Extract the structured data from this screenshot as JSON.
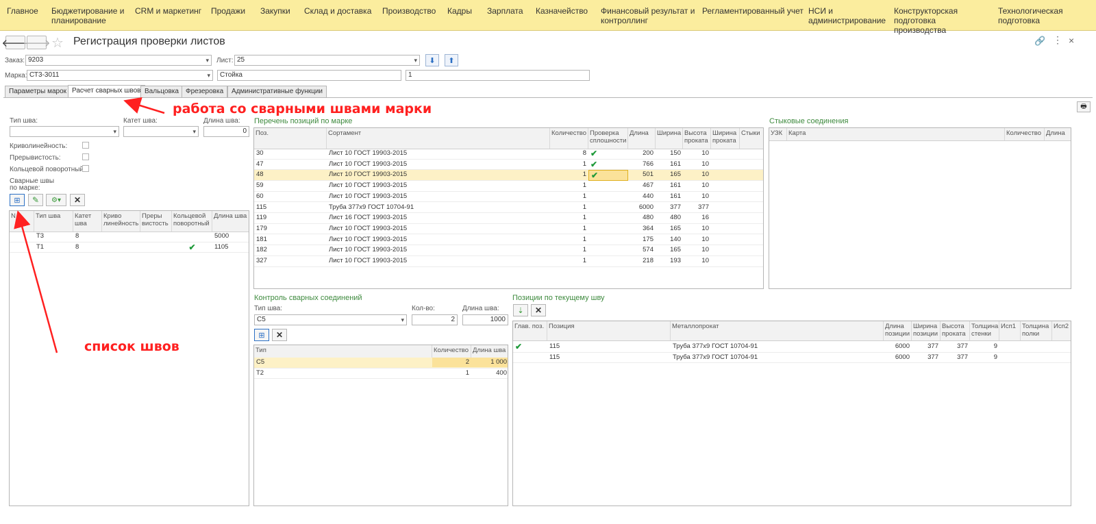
{
  "menu": [
    "Главное",
    "Бюджетирование и планирование",
    "CRM и маркетинг",
    "Продажи",
    "Закупки",
    "Склад и доставка",
    "Производство",
    "Кадры",
    "Зарплата",
    "Казначейство",
    "Финансовый результат и контроллинг",
    "Регламентированный учет",
    "НСИ и администрирование",
    "Конструкторская подготовка производства",
    "Технологическая подготовка производства"
  ],
  "header": {
    "title": "Регистрация проверки листов",
    "close": "×"
  },
  "form": {
    "order_label": "Заказ:",
    "order_value": "9203",
    "sheet_label": "Лист:",
    "sheet_value": "25",
    "mark_label": "Марка:",
    "mark_value": "СТ3-3011",
    "mark_name": "Стойка",
    "mark_qty": "1"
  },
  "tabs": [
    "Параметры марок",
    "Расчет сварных швов",
    "Вальцовка",
    "Фрезеровка",
    "Административные функции"
  ],
  "left": {
    "seam_type_label": "Тип шва:",
    "cathet_label": "Катет шва:",
    "length_label": "Длина шва:",
    "length_value": "0",
    "curv_label": "Криволинейность:",
    "interr_label": "Прерывистость:",
    "ring_label": "Кольцевой поворотный:",
    "seams_label_1": "Сварные швы",
    "seams_label_2": "по марке:",
    "headers": [
      "N",
      "Тип шва",
      "Катет шва",
      "Криво линейность",
      "Преры вистость",
      "Кольцевой поворотный",
      "Длина шва"
    ],
    "rows": [
      {
        "n": "",
        "type": "Т3",
        "cathet": "8",
        "curv": "",
        "interr": "",
        "ring": "",
        "len": "5000"
      },
      {
        "n": "",
        "type": "Т1",
        "cathet": "8",
        "curv": "",
        "interr": "",
        "ring": "✔",
        "len": "1105"
      }
    ]
  },
  "positions": {
    "title": "Перечень позиций по марке",
    "headers": [
      "Поз.",
      "Сортамент",
      "Количество",
      "Проверка сплошности",
      "Длина",
      "Ширина",
      "Высота проката",
      "Ширина проката",
      "Стыки"
    ],
    "rows": [
      {
        "pos": "30",
        "sort": "Лист 10 ГОСТ 19903-2015",
        "qty": "8",
        "chk": "✔",
        "len": "200",
        "wid": "150",
        "h": "10",
        "wp": "",
        "st": ""
      },
      {
        "pos": "47",
        "sort": "Лист 10 ГОСТ 19903-2015",
        "qty": "1",
        "chk": "✔",
        "len": "766",
        "wid": "161",
        "h": "10",
        "wp": "",
        "st": ""
      },
      {
        "pos": "48",
        "sort": "Лист 10 ГОСТ 19903-2015",
        "qty": "1",
        "chk": "✔",
        "len": "501",
        "wid": "165",
        "h": "10",
        "wp": "",
        "st": ""
      },
      {
        "pos": "59",
        "sort": "Лист 10 ГОСТ 19903-2015",
        "qty": "1",
        "chk": "",
        "len": "467",
        "wid": "161",
        "h": "10",
        "wp": "",
        "st": ""
      },
      {
        "pos": "60",
        "sort": "Лист 10 ГОСТ 19903-2015",
        "qty": "1",
        "chk": "",
        "len": "440",
        "wid": "161",
        "h": "10",
        "wp": "",
        "st": ""
      },
      {
        "pos": "115",
        "sort": "Труба 377х9 ГОСТ 10704-91",
        "qty": "1",
        "chk": "",
        "len": "6000",
        "wid": "377",
        "h": "377",
        "wp": "",
        "st": ""
      },
      {
        "pos": "119",
        "sort": "Лист 16 ГОСТ 19903-2015",
        "qty": "1",
        "chk": "",
        "len": "480",
        "wid": "480",
        "h": "16",
        "wp": "",
        "st": ""
      },
      {
        "pos": "179",
        "sort": "Лист 10 ГОСТ 19903-2015",
        "qty": "1",
        "chk": "",
        "len": "364",
        "wid": "165",
        "h": "10",
        "wp": "",
        "st": ""
      },
      {
        "pos": "181",
        "sort": "Лист 10 ГОСТ 19903-2015",
        "qty": "1",
        "chk": "",
        "len": "175",
        "wid": "140",
        "h": "10",
        "wp": "",
        "st": ""
      },
      {
        "pos": "182",
        "sort": "Лист 10 ГОСТ 19903-2015",
        "qty": "1",
        "chk": "",
        "len": "574",
        "wid": "165",
        "h": "10",
        "wp": "",
        "st": ""
      },
      {
        "pos": "327",
        "sort": "Лист 10 ГОСТ 19903-2015",
        "qty": "1",
        "chk": "",
        "len": "218",
        "wid": "193",
        "h": "10",
        "wp": "",
        "st": ""
      }
    ]
  },
  "joints": {
    "title": "Стыковые соединения",
    "headers": [
      "УЗК",
      "Карта",
      "Количество",
      "Длина"
    ]
  },
  "control": {
    "title": "Контроль сварных соединений",
    "type_label": "Тип шва:",
    "type_value": "С5",
    "qty_label": "Кол-во:",
    "qty_value": "2",
    "len_label": "Длина шва:",
    "len_value": "1000",
    "headers": [
      "Тип",
      "Количество",
      "Длина шва"
    ],
    "rows": [
      {
        "type": "С5",
        "qty": "2",
        "len": "1 000"
      },
      {
        "type": "Т2",
        "qty": "1",
        "len": "400"
      }
    ]
  },
  "current": {
    "title": "Позиции по текущему шву",
    "headers": [
      "Глав. поз.",
      "Позиция",
      "Металлопрокат",
      "Длина позиции",
      "Ширина позиции",
      "Высота проката",
      "Толщина стенки",
      "Исп1",
      "Толщина полки",
      "Исп2"
    ],
    "rows": [
      {
        "main": "✔",
        "pos": "115",
        "metal": "Труба 377х9 ГОСТ 10704-91",
        "len": "6000",
        "wid": "377",
        "h": "377",
        "t": "9",
        "i1": "",
        "tp": "",
        "i2": ""
      },
      {
        "main": "",
        "pos": "115",
        "metal": "Труба 377х9 ГОСТ 10704-91",
        "len": "6000",
        "wid": "377",
        "h": "377",
        "t": "9",
        "i1": "",
        "tp": "",
        "i2": ""
      }
    ]
  },
  "annotations": {
    "welds": "работа со сварными швами марки",
    "list": "список швов"
  },
  "colors": {
    "menu_bg": "#fbed9e",
    "section_title": "#3e8a3e",
    "selected_row": "#fdf1c6",
    "annotation": "#ff2020",
    "check": "#1f9a3a"
  }
}
